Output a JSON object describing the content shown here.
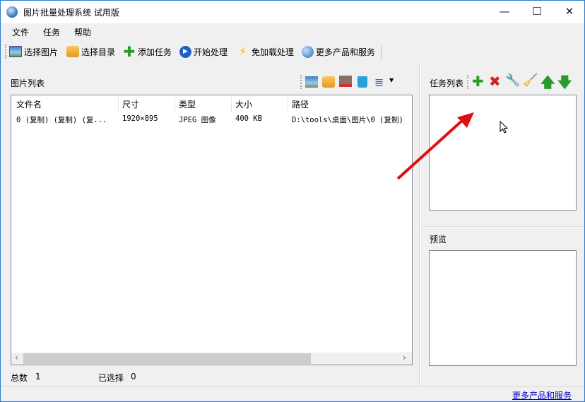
{
  "window": {
    "title": "图片批量处理系统 试用版",
    "minimize": "—",
    "maximize": "☐",
    "close": "✕"
  },
  "menu": [
    "文件",
    "任务",
    "帮助"
  ],
  "toolbar": [
    {
      "label": "选择图片",
      "icon": "image-icon"
    },
    {
      "label": "选择目录",
      "icon": "folder-icon"
    },
    {
      "label": "添加任务",
      "icon": "plus-icon"
    },
    {
      "label": "开始处理",
      "icon": "play-icon"
    },
    {
      "label": "免加载处理",
      "icon": "lightning-icon"
    },
    {
      "label": "更多产品和服务",
      "icon": "globe-icon"
    }
  ],
  "image_list": {
    "title": "图片列表",
    "columns": [
      "文件名",
      "尺寸",
      "类型",
      "大小",
      "路径"
    ],
    "rows": [
      [
        "0 (复制) (复制) (复...",
        "1920×895",
        "JPEG 图像",
        "400 KB",
        "D:\\tools\\桌面\\图片\\0 (复制)"
      ]
    ],
    "total_label": "总数",
    "total": "1",
    "selected_label": "已选择",
    "selected": "0"
  },
  "task_list": {
    "title": "任务列表"
  },
  "preview": {
    "title": "预览"
  },
  "footer": {
    "link": "更多产品和服务"
  },
  "colors": {
    "accent": "#2b7bd0",
    "arrow": "#e01010",
    "link": "#0000cc"
  }
}
